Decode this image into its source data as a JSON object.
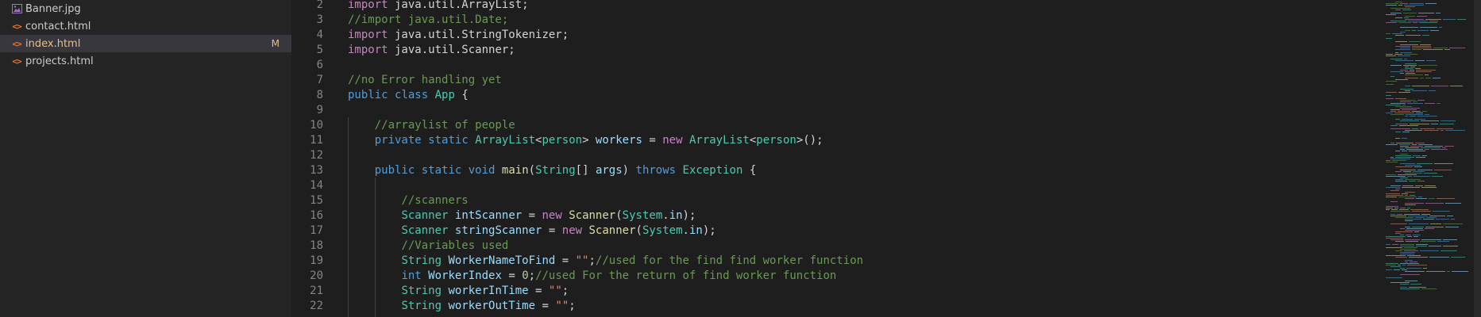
{
  "explorer": {
    "files": [
      {
        "name": "Banner.jpg",
        "type": "image",
        "active": false,
        "badge": ""
      },
      {
        "name": "contact.html",
        "type": "html",
        "active": false,
        "badge": ""
      },
      {
        "name": "index.html",
        "type": "html",
        "active": true,
        "badge": "M"
      },
      {
        "name": "projects.html",
        "type": "html",
        "active": false,
        "badge": ""
      }
    ]
  },
  "editor": {
    "lines": [
      {
        "n": "2",
        "tokens": [
          [
            "kw2",
            "import"
          ],
          [
            "plain",
            " java.util.ArrayList;"
          ]
        ]
      },
      {
        "n": "3",
        "tokens": [
          [
            "cm",
            "//import java.util.Date;"
          ]
        ]
      },
      {
        "n": "4",
        "tokens": [
          [
            "kw2",
            "import"
          ],
          [
            "plain",
            " java.util.StringTokenizer;"
          ]
        ]
      },
      {
        "n": "5",
        "tokens": [
          [
            "kw2",
            "import"
          ],
          [
            "plain",
            " java.util.Scanner;"
          ]
        ]
      },
      {
        "n": "6",
        "tokens": []
      },
      {
        "n": "7",
        "tokens": [
          [
            "cm",
            "//no Error handling yet"
          ]
        ]
      },
      {
        "n": "8",
        "tokens": [
          [
            "kw",
            "public"
          ],
          [
            "plain",
            " "
          ],
          [
            "kw",
            "class"
          ],
          [
            "plain",
            " "
          ],
          [
            "ty",
            "App"
          ],
          [
            "plain",
            " {"
          ]
        ]
      },
      {
        "n": "9",
        "tokens": []
      },
      {
        "n": "10",
        "tokens": [
          [
            "plain",
            "    "
          ],
          [
            "cm",
            "//arraylist of people"
          ]
        ]
      },
      {
        "n": "11",
        "tokens": [
          [
            "plain",
            "    "
          ],
          [
            "kw",
            "private"
          ],
          [
            "plain",
            " "
          ],
          [
            "kw",
            "static"
          ],
          [
            "plain",
            " "
          ],
          [
            "ty",
            "ArrayList"
          ],
          [
            "plain",
            "<"
          ],
          [
            "ty",
            "person"
          ],
          [
            "plain",
            "> "
          ],
          [
            "var",
            "workers"
          ],
          [
            "plain",
            " = "
          ],
          [
            "kw2",
            "new"
          ],
          [
            "plain",
            " "
          ],
          [
            "ty",
            "ArrayList"
          ],
          [
            "plain",
            "<"
          ],
          [
            "ty",
            "person"
          ],
          [
            "plain",
            ">();"
          ]
        ]
      },
      {
        "n": "12",
        "tokens": []
      },
      {
        "n": "13",
        "tokens": [
          [
            "plain",
            "    "
          ],
          [
            "kw",
            "public"
          ],
          [
            "plain",
            " "
          ],
          [
            "kw",
            "static"
          ],
          [
            "plain",
            " "
          ],
          [
            "kw",
            "void"
          ],
          [
            "plain",
            " "
          ],
          [
            "fn",
            "main"
          ],
          [
            "plain",
            "("
          ],
          [
            "ty",
            "String"
          ],
          [
            "plain",
            "[] "
          ],
          [
            "var",
            "args"
          ],
          [
            "plain",
            ") "
          ],
          [
            "kw",
            "throws"
          ],
          [
            "plain",
            " "
          ],
          [
            "ty",
            "Exception"
          ],
          [
            "plain",
            " {"
          ]
        ]
      },
      {
        "n": "14",
        "tokens": []
      },
      {
        "n": "15",
        "tokens": [
          [
            "plain",
            "        "
          ],
          [
            "cm",
            "//scanners"
          ]
        ]
      },
      {
        "n": "16",
        "tokens": [
          [
            "plain",
            "        "
          ],
          [
            "ty",
            "Scanner"
          ],
          [
            "plain",
            " "
          ],
          [
            "var",
            "intScanner"
          ],
          [
            "plain",
            " = "
          ],
          [
            "kw2",
            "new"
          ],
          [
            "plain",
            " "
          ],
          [
            "fn",
            "Scanner"
          ],
          [
            "plain",
            "("
          ],
          [
            "ty",
            "System"
          ],
          [
            "plain",
            "."
          ],
          [
            "var",
            "in"
          ],
          [
            "plain",
            ");"
          ]
        ]
      },
      {
        "n": "17",
        "tokens": [
          [
            "plain",
            "        "
          ],
          [
            "ty",
            "Scanner"
          ],
          [
            "plain",
            " "
          ],
          [
            "var",
            "stringScanner"
          ],
          [
            "plain",
            " = "
          ],
          [
            "kw2",
            "new"
          ],
          [
            "plain",
            " "
          ],
          [
            "fn",
            "Scanner"
          ],
          [
            "plain",
            "("
          ],
          [
            "ty",
            "System"
          ],
          [
            "plain",
            "."
          ],
          [
            "var",
            "in"
          ],
          [
            "plain",
            ");"
          ]
        ]
      },
      {
        "n": "18",
        "tokens": [
          [
            "plain",
            "        "
          ],
          [
            "cm",
            "//Variables used"
          ]
        ]
      },
      {
        "n": "19",
        "tokens": [
          [
            "plain",
            "        "
          ],
          [
            "ty",
            "String"
          ],
          [
            "plain",
            " "
          ],
          [
            "var",
            "WorkerNameToFind"
          ],
          [
            "plain",
            " = "
          ],
          [
            "str",
            "\"\""
          ],
          [
            "plain",
            ";"
          ],
          [
            "cm",
            "//used for the find find worker function"
          ]
        ]
      },
      {
        "n": "20",
        "tokens": [
          [
            "plain",
            "        "
          ],
          [
            "kw",
            "int"
          ],
          [
            "plain",
            " "
          ],
          [
            "var",
            "WorkerIndex"
          ],
          [
            "plain",
            " = "
          ],
          [
            "num",
            "0"
          ],
          [
            "plain",
            ";"
          ],
          [
            "cm",
            "//used For the return of find worker function"
          ]
        ]
      },
      {
        "n": "21",
        "tokens": [
          [
            "plain",
            "        "
          ],
          [
            "ty",
            "String"
          ],
          [
            "plain",
            " "
          ],
          [
            "var",
            "workerInTime"
          ],
          [
            "plain",
            " = "
          ],
          [
            "str",
            "\"\""
          ],
          [
            "plain",
            ";"
          ]
        ]
      },
      {
        "n": "22",
        "tokens": [
          [
            "plain",
            "        "
          ],
          [
            "ty",
            "String"
          ],
          [
            "plain",
            " "
          ],
          [
            "var",
            "workerOutTime"
          ],
          [
            "plain",
            " = "
          ],
          [
            "str",
            "\"\""
          ],
          [
            "plain",
            ";"
          ]
        ]
      }
    ]
  },
  "colors": {
    "background": "#1e1e1e",
    "sidebar": "#252526",
    "active_row": "#37373d",
    "modified": "#e2c08d"
  },
  "icons": {
    "image": "image-file-icon",
    "html": "html-code-icon"
  }
}
